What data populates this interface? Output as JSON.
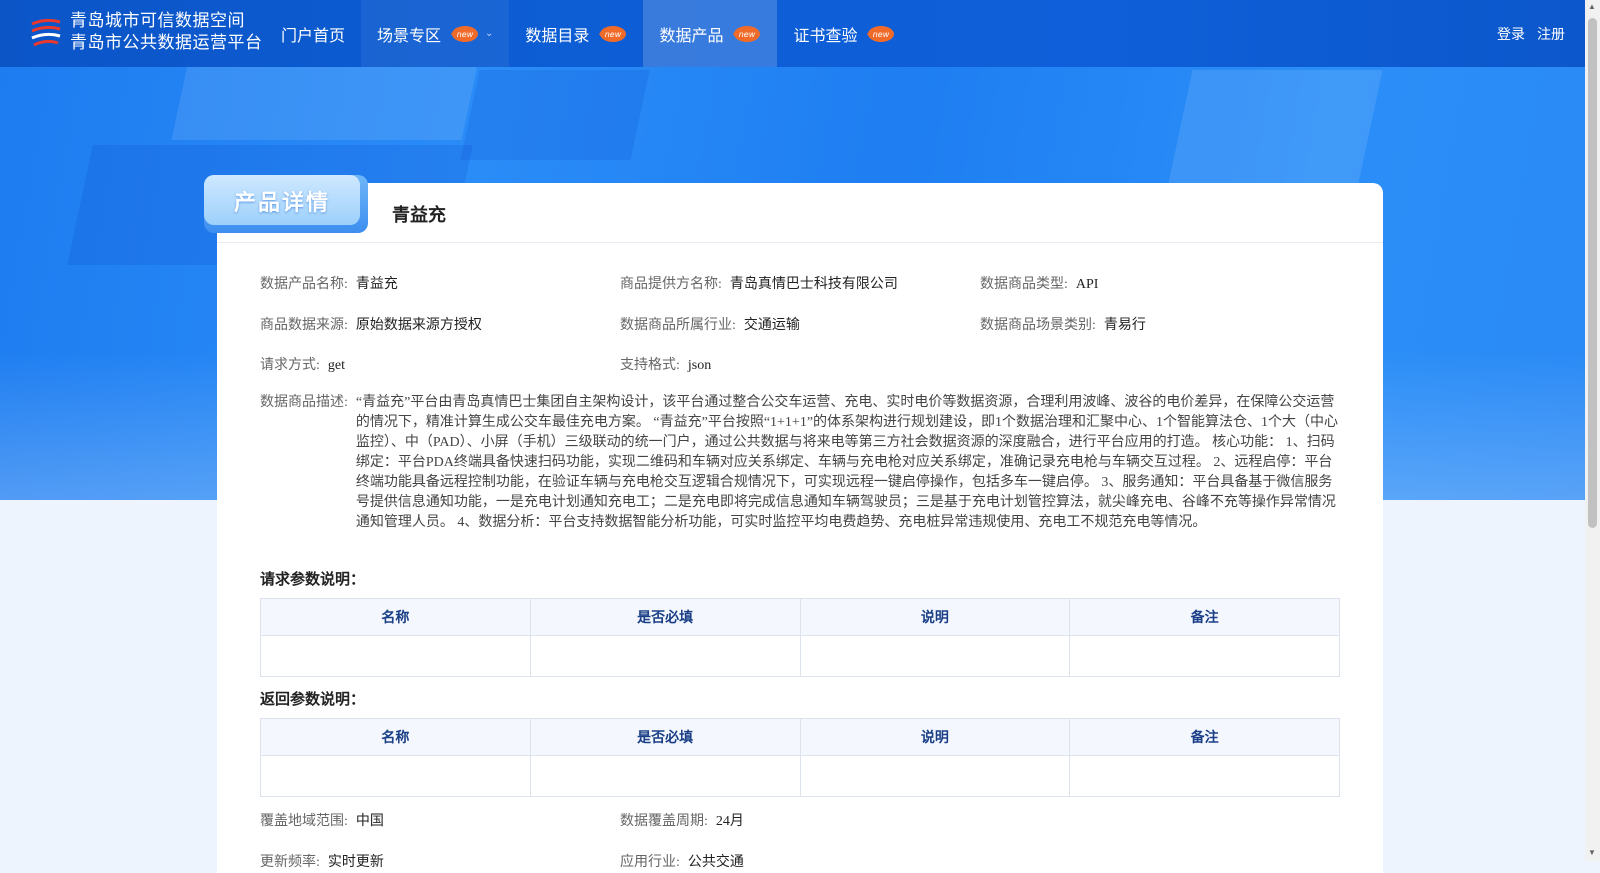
{
  "header": {
    "brand_line1": "青岛城市可信数据空间",
    "brand_line2": "青岛市公共数据运营平台",
    "nav": [
      {
        "label": "门户首页",
        "new": false
      },
      {
        "label": "场景专区",
        "new": true
      },
      {
        "label": "数据目录",
        "new": true
      },
      {
        "label": "数据产品",
        "new": true
      },
      {
        "label": "证书查验",
        "new": true
      }
    ],
    "new_badge_text": "new",
    "login": "登录",
    "register": "注册"
  },
  "product": {
    "tab_label": "产品详情",
    "title": "青益充",
    "fields": {
      "name_label": "数据产品名称:",
      "name": "青益充",
      "provider_label": "商品提供方名称:",
      "provider": "青岛真情巴士科技有限公司",
      "type_label": "数据商品类型:",
      "type": "API",
      "source_label": "商品数据来源:",
      "source": "原始数据来源方授权",
      "industry_label": "数据商品所属行业:",
      "industry": "交通运输",
      "scene_label": "数据商品场景类别:",
      "scene": "青易行",
      "method_label": "请求方式:",
      "method": "get",
      "format_label": "支持格式:",
      "format": "json",
      "desc_label": "数据商品描述:",
      "desc": "“青益充”平台由青岛真情巴士集团自主架构设计，该平台通过整合公交车运营、充电、实时电价等数据资源，合理利用波峰、波谷的电价差异，在保障公交运营的情况下，精准计算生成公交车最佳充电方案。 “青益充”平台按照“1+1+1”的体系架构进行规划建设，即1个数据治理和汇聚中心、1个智能算法仓、1个大（中心监控）、中（PAD）、小屏（手机）三级联动的统一门户，通过公共数据与将来电等第三方社会数据资源的深度融合，进行平台应用的打造。 核心功能： 1、扫码绑定：平台PDA终端具备快速扫码功能，实现二维码和车辆对应关系绑定、车辆与充电枪对应关系绑定，准确记录充电枪与车辆交互过程。 2、远程启停：平台终端功能具备远程控制功能，在验证车辆与充电枪交互逻辑合规情况下，可实现远程一键启停操作，包括多车一键启停。 3、服务通知：平台具备基于微信服务号提供信息通知功能，一是充电计划通知充电工；二是充电即将完成信息通知车辆驾驶员；三是基于充电计划管控算法，就尖峰充电、谷峰不充等操作异常情况通知管理人员。 4、数据分析：平台支持数据智能分析功能，可实时监控平均电费趋势、充电桩异常违规使用、充电工不规范充电等情况。",
      "coverage_label": "覆盖地域范围:",
      "coverage": "中国",
      "period_label": "数据覆盖周期:",
      "period": "24月",
      "freq_label": "更新频率:",
      "freq": "实时更新",
      "app_industry_label": "应用行业:",
      "app_industry": "公共交通"
    },
    "request_params_title": "请求参数说明：",
    "response_params_title": "返回参数说明：",
    "param_columns": [
      "名称",
      "是否必填",
      "说明",
      "备注"
    ]
  },
  "colors": {
    "nav_bg": "#0d5ed6",
    "hero_bg": "#1e7ef2",
    "table_header_text": "#1a3f86"
  }
}
